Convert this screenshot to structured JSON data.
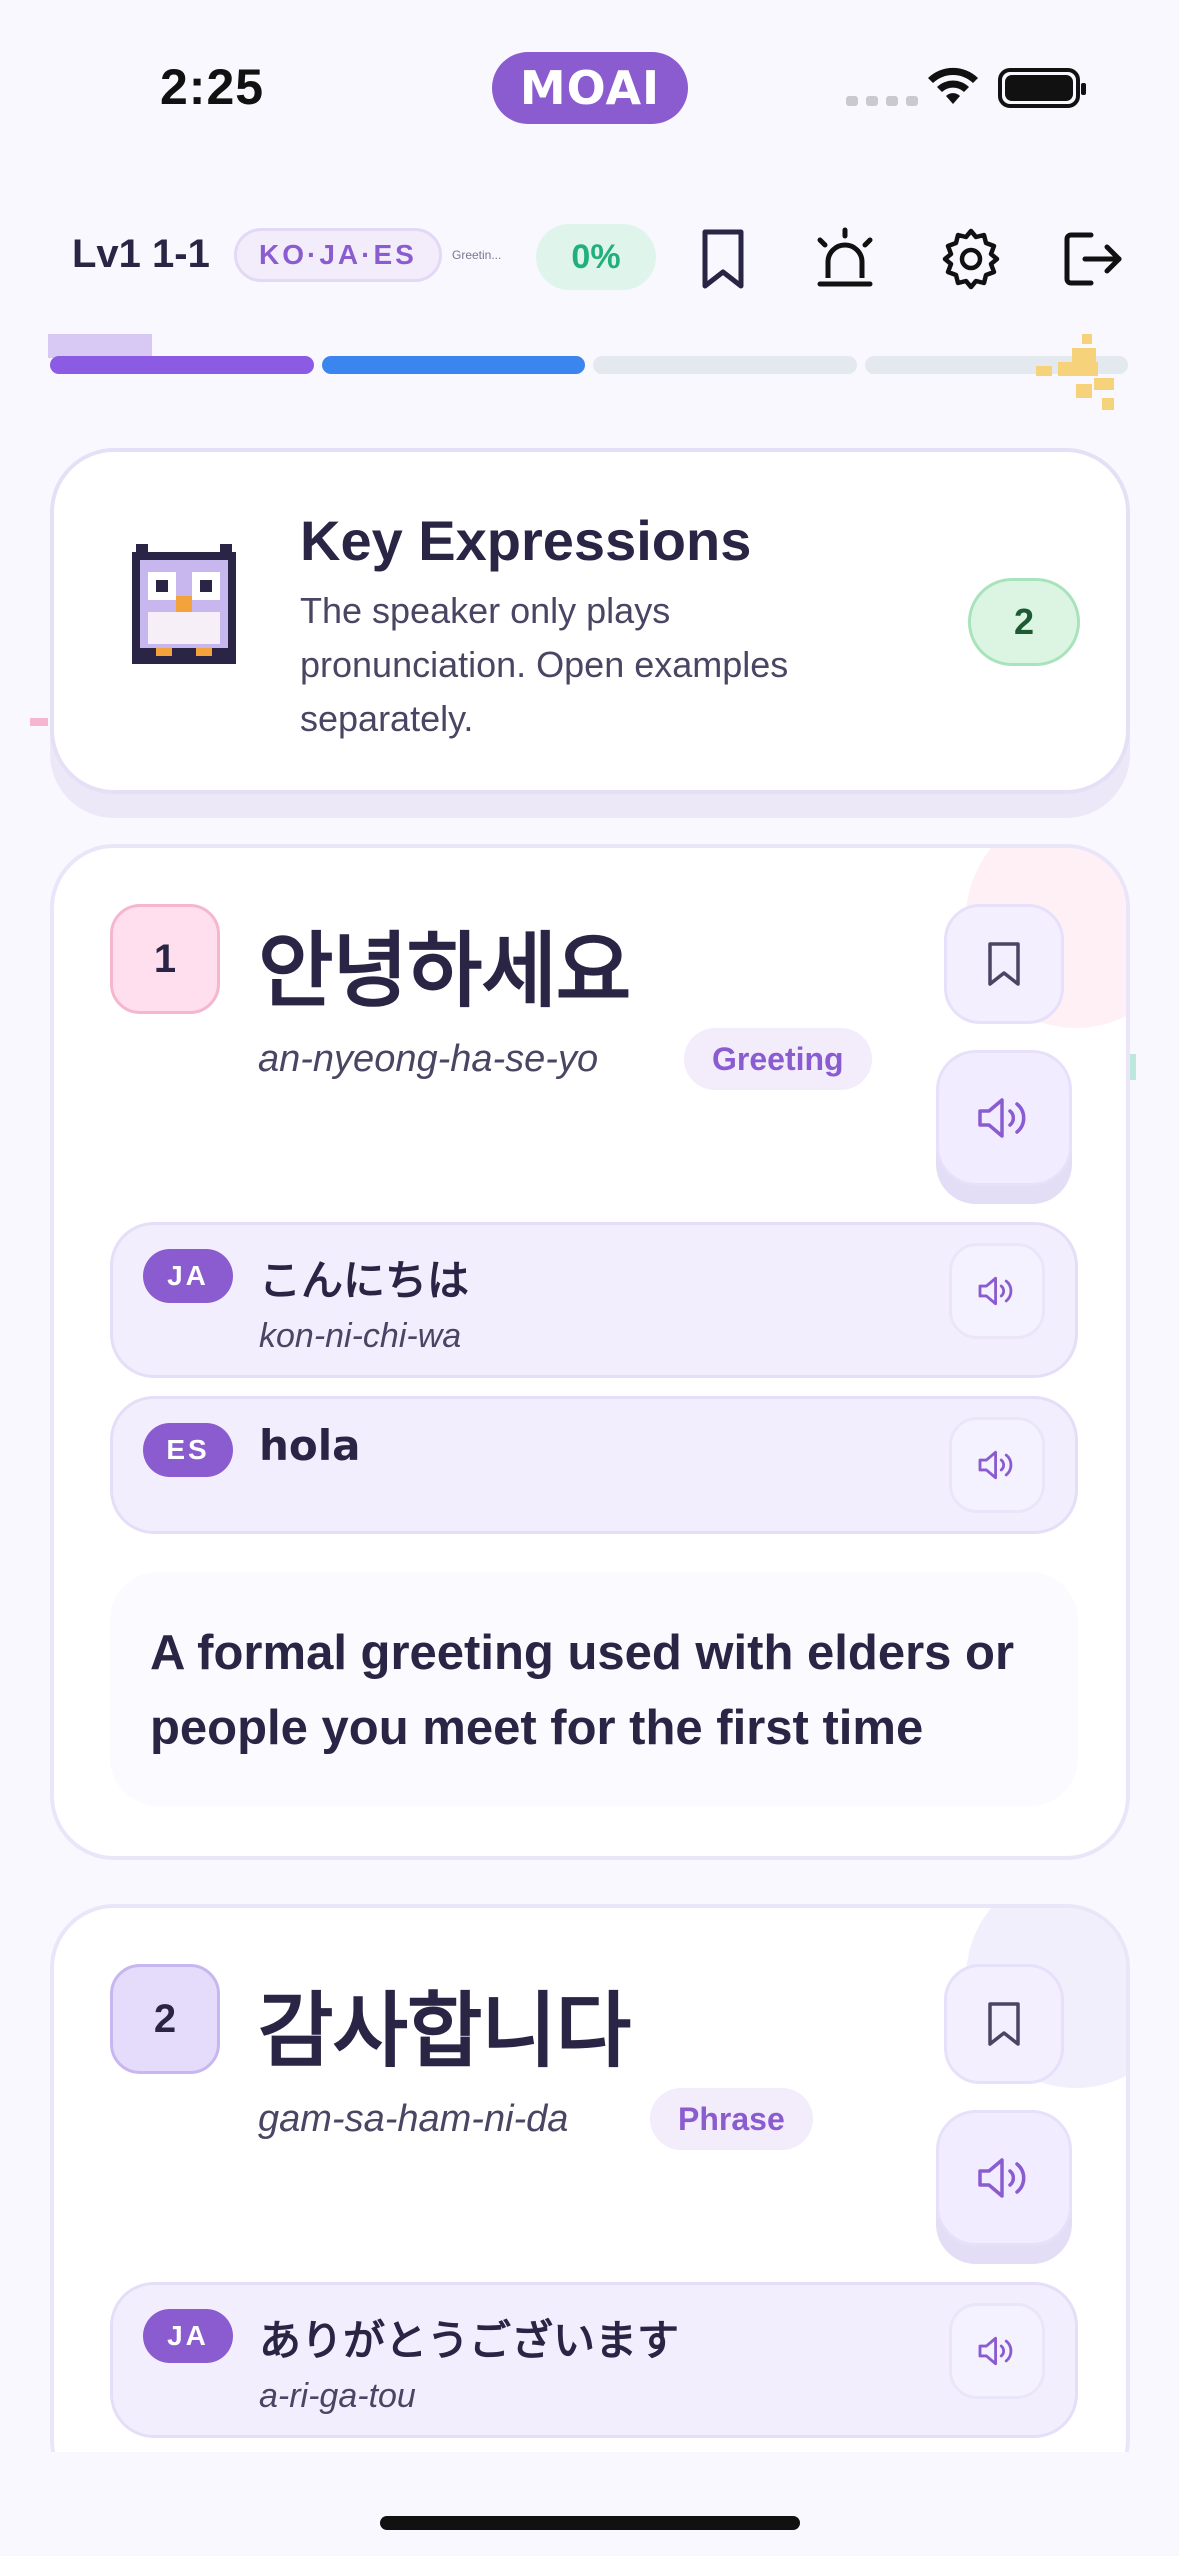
{
  "status_bar": {
    "time": "2:25",
    "pill_label": "MOAI"
  },
  "toolbar": {
    "level": "Lv1 1-1",
    "languages": "KO·JA·ES",
    "tiny_label": "Greetin...",
    "percent": "0%",
    "icons": [
      "bookmark-icon",
      "siren-icon",
      "gear-icon",
      "logout-icon"
    ]
  },
  "progress": {
    "segments": [
      "complete",
      "active",
      "pending",
      "pending"
    ]
  },
  "header": {
    "title": "Key Expressions",
    "subtitle": "The speaker only plays pronunciation. Open examples separately.",
    "count": "2"
  },
  "expressions": [
    {
      "number": "1",
      "korean": "안녕하세요",
      "romanization": "an-nyeong-ha-se-yo",
      "tag": "Greeting",
      "translations": [
        {
          "lang": "JA",
          "text": "こんにちは",
          "romanization": "kon-ni-chi-wa"
        },
        {
          "lang": "ES",
          "text": "hola",
          "romanization": ""
        }
      ],
      "note": "A formal greeting used with elders or people you meet for the first time"
    },
    {
      "number": "2",
      "korean": "감사합니다",
      "romanization": "gam-sa-ham-ni-da",
      "tag": "Phrase",
      "translations": [
        {
          "lang": "JA",
          "text": "ありがとうございます",
          "romanization": "a-ri-ga-tou"
        }
      ]
    }
  ],
  "colors": {
    "accent": "#8a5cd0",
    "progress_complete": "#8b5be4",
    "progress_active": "#3b86ee",
    "success": "#21b07a"
  }
}
